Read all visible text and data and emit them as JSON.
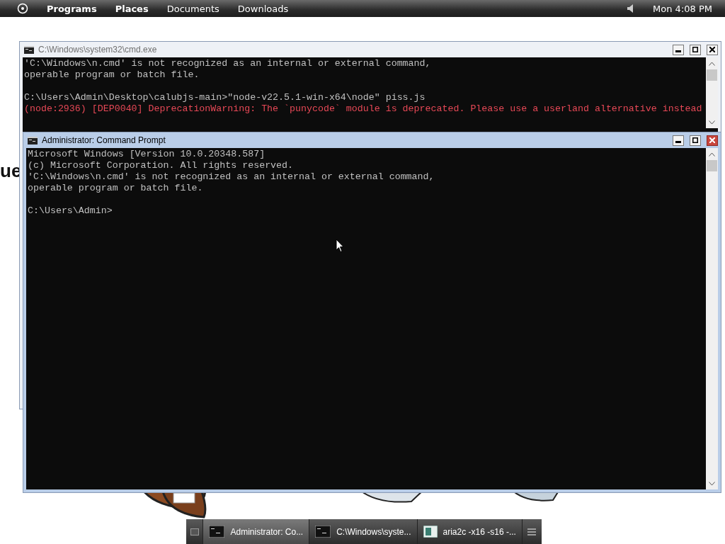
{
  "top_panel": {
    "menus": [
      {
        "label": "Programs",
        "kind": "menu"
      },
      {
        "label": "Places",
        "kind": "menu"
      },
      {
        "label": "Documents",
        "kind": "bookmark"
      },
      {
        "label": "Downloads",
        "kind": "bookmark"
      }
    ],
    "clock": "Mon 4:08 PM"
  },
  "background_text": "ue",
  "windows": [
    {
      "title": "C:\\Windows\\system32\\cmd.exe",
      "active": false,
      "lines": [
        {
          "text": "'C:\\Windows\\n.cmd' is not recognized as an internal or external command,",
          "kind": "output"
        },
        {
          "text": "operable program or batch file.",
          "kind": "output"
        },
        {
          "kind": "blank"
        },
        {
          "text": "C:\\Users\\Admin\\Desktop\\calubjs-main>\"node-v22.5.1-win-x64\\node\" piss.js",
          "kind": "output"
        },
        {
          "text": "(node:2936) [DEP0040] DeprecationWarning: The `punycode` module is deprecated. Please use a userland alternative instead",
          "kind": "error"
        }
      ]
    },
    {
      "title": "Administrator: Command Prompt",
      "active": true,
      "lines": [
        {
          "text": "Microsoft Windows [Version 10.0.20348.587]",
          "kind": "output"
        },
        {
          "text": "(c) Microsoft Corporation. All rights reserved.",
          "kind": "output"
        },
        {
          "text": "'C:\\Windows\\n.cmd' is not recognized as an internal or external command,",
          "kind": "output"
        },
        {
          "text": "operable program or batch file.",
          "kind": "output"
        },
        {
          "kind": "blank"
        },
        {
          "text": "C:\\Users\\Admin>",
          "kind": "output"
        }
      ]
    }
  ],
  "taskbar": {
    "items": [
      {
        "label": "Administrator: Co...",
        "kind": "console",
        "selected": true
      },
      {
        "label": "C:\\Windows\\syste...",
        "kind": "console",
        "selected": false
      },
      {
        "label": "aria2c  -x16 -s16 -...",
        "kind": "app",
        "selected": false
      }
    ]
  }
}
